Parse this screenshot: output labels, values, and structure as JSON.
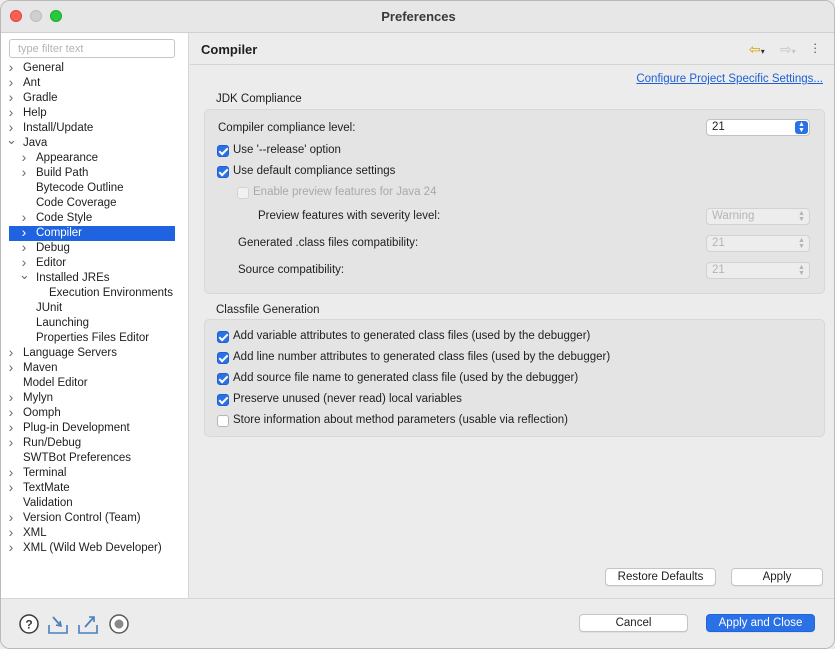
{
  "window": {
    "title": "Preferences"
  },
  "sidebar": {
    "filter_placeholder": "type filter text",
    "items": [
      {
        "label": "General",
        "level": 0,
        "chevron": "right"
      },
      {
        "label": "Ant",
        "level": 0,
        "chevron": "right"
      },
      {
        "label": "Gradle",
        "level": 0,
        "chevron": "right"
      },
      {
        "label": "Help",
        "level": 0,
        "chevron": "right"
      },
      {
        "label": "Install/Update",
        "level": 0,
        "chevron": "right"
      },
      {
        "label": "Java",
        "level": 0,
        "chevron": "down"
      },
      {
        "label": "Appearance",
        "level": 1,
        "chevron": "right"
      },
      {
        "label": "Build Path",
        "level": 1,
        "chevron": "right"
      },
      {
        "label": "Bytecode Outline",
        "level": 1,
        "chevron": ""
      },
      {
        "label": "Code Coverage",
        "level": 1,
        "chevron": ""
      },
      {
        "label": "Code Style",
        "level": 1,
        "chevron": "right"
      },
      {
        "label": "Compiler",
        "level": 1,
        "chevron": "right",
        "selected": true
      },
      {
        "label": "Debug",
        "level": 1,
        "chevron": "right"
      },
      {
        "label": "Editor",
        "level": 1,
        "chevron": "right"
      },
      {
        "label": "Installed JREs",
        "level": 1,
        "chevron": "down"
      },
      {
        "label": "Execution Environments",
        "level": 2,
        "chevron": ""
      },
      {
        "label": "JUnit",
        "level": 1,
        "chevron": ""
      },
      {
        "label": "Launching",
        "level": 1,
        "chevron": ""
      },
      {
        "label": "Properties Files Editor",
        "level": 1,
        "chevron": ""
      },
      {
        "label": "Language Servers",
        "level": 0,
        "chevron": "right"
      },
      {
        "label": "Maven",
        "level": 0,
        "chevron": "right"
      },
      {
        "label": "Model Editor",
        "level": 0,
        "chevron": ""
      },
      {
        "label": "Mylyn",
        "level": 0,
        "chevron": "right"
      },
      {
        "label": "Oomph",
        "level": 0,
        "chevron": "right"
      },
      {
        "label": "Plug-in Development",
        "level": 0,
        "chevron": "right"
      },
      {
        "label": "Run/Debug",
        "level": 0,
        "chevron": "right"
      },
      {
        "label": "SWTBot Preferences",
        "level": 0,
        "chevron": ""
      },
      {
        "label": "Terminal",
        "level": 0,
        "chevron": "right"
      },
      {
        "label": "TextMate",
        "level": 0,
        "chevron": "right"
      },
      {
        "label": "Validation",
        "level": 0,
        "chevron": ""
      },
      {
        "label": "Version Control (Team)",
        "level": 0,
        "chevron": "right"
      },
      {
        "label": "XML",
        "level": 0,
        "chevron": "right"
      },
      {
        "label": "XML (Wild Web Developer)",
        "level": 0,
        "chevron": "right"
      }
    ]
  },
  "page": {
    "title": "Compiler",
    "configure_link": "Configure Project Specific Settings...",
    "jdk": {
      "group_label": "JDK Compliance",
      "compliance_label": "Compiler compliance level:",
      "compliance_value": "21",
      "use_release_label": "Use '--release' option",
      "use_release_checked": true,
      "use_default_label": "Use default compliance settings",
      "use_default_checked": true,
      "enable_preview_label": "Enable preview features for Java 24",
      "enable_preview_checked": false,
      "severity_label": "Preview features with severity level:",
      "severity_value": "Warning",
      "classfile_compat_label": "Generated .class files compatibility:",
      "classfile_compat_value": "21",
      "source_compat_label": "Source compatibility:",
      "source_compat_value": "21"
    },
    "classfile": {
      "group_label": "Classfile Generation",
      "options": [
        {
          "label": "Add variable attributes to generated class files (used by the debugger)",
          "checked": true
        },
        {
          "label": "Add line number attributes to generated class files (used by the debugger)",
          "checked": true
        },
        {
          "label": "Add source file name to generated class file (used by the debugger)",
          "checked": true
        },
        {
          "label": "Preserve unused (never read) local variables",
          "checked": true
        },
        {
          "label": "Store information about method parameters (usable via reflection)",
          "checked": false
        }
      ]
    },
    "restore_defaults_label": "Restore Defaults",
    "apply_label": "Apply"
  },
  "footer": {
    "cancel_label": "Cancel",
    "apply_close_label": "Apply and Close",
    "icons": [
      "help-icon",
      "import-icon",
      "export-icon",
      "record-icon"
    ]
  },
  "colors": {
    "accent": "#2b71e6",
    "link": "#1f5fd6",
    "selection": "#1f63e0"
  }
}
